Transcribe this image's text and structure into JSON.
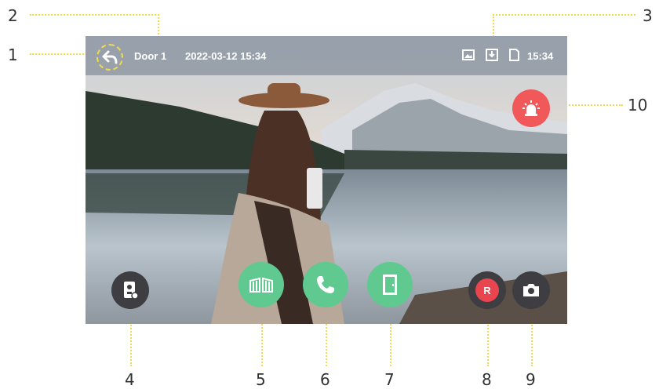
{
  "header": {
    "door_label": "Door 1",
    "datetime": "2022-03-12 15:34",
    "clock": "15:34"
  },
  "callouts": [
    "1",
    "2",
    "3",
    "4",
    "5",
    "6",
    "7",
    "8",
    "9",
    "10"
  ],
  "buttons": {
    "record_label": "R"
  },
  "icons": {
    "back": "back-arrow-icon",
    "gallery": "image-icon",
    "download": "download-icon",
    "sdcard": "sd-card-icon",
    "monitor": "monitor-switch-icon",
    "unlock": "gate-unlock-icon",
    "call": "phone-icon",
    "door": "door-icon",
    "record": "record-icon",
    "snapshot": "camera-icon",
    "alarm": "alarm-siren-icon"
  },
  "colors": {
    "accent_green": "#5fc98f",
    "dark_button": "#3d3d42",
    "alarm_red": "#f0585a",
    "record_red": "#e8454f",
    "callout_line": "#f2dc4a"
  }
}
